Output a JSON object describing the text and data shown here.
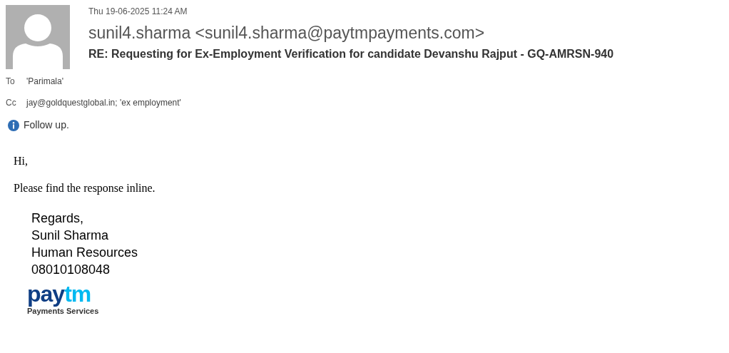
{
  "header": {
    "date": "Thu 19-06-2025 11:24 AM",
    "sender": "sunil4.sharma <sunil4.sharma@paytmpayments.com>",
    "subject": "RE: Requesting for Ex-Employment Verification for candidate Devanshu Rajput - GQ-AMRSN-940"
  },
  "recipients": [
    {
      "label": "To",
      "value": "'Parimala'"
    },
    {
      "label": "Cc",
      "value": "jay@goldquestglobal.in; 'ex employment'"
    }
  ],
  "info": {
    "text": "Follow up."
  },
  "body": [
    "Hi,",
    "Please find the response inline."
  ],
  "signature": [
    "Regards,",
    "Sunil Sharma",
    "Human Resources",
    "08010108048"
  ],
  "logo": {
    "wordmark_dark": "pay",
    "wordmark_light": "tm",
    "tagline": "Payments Services"
  }
}
